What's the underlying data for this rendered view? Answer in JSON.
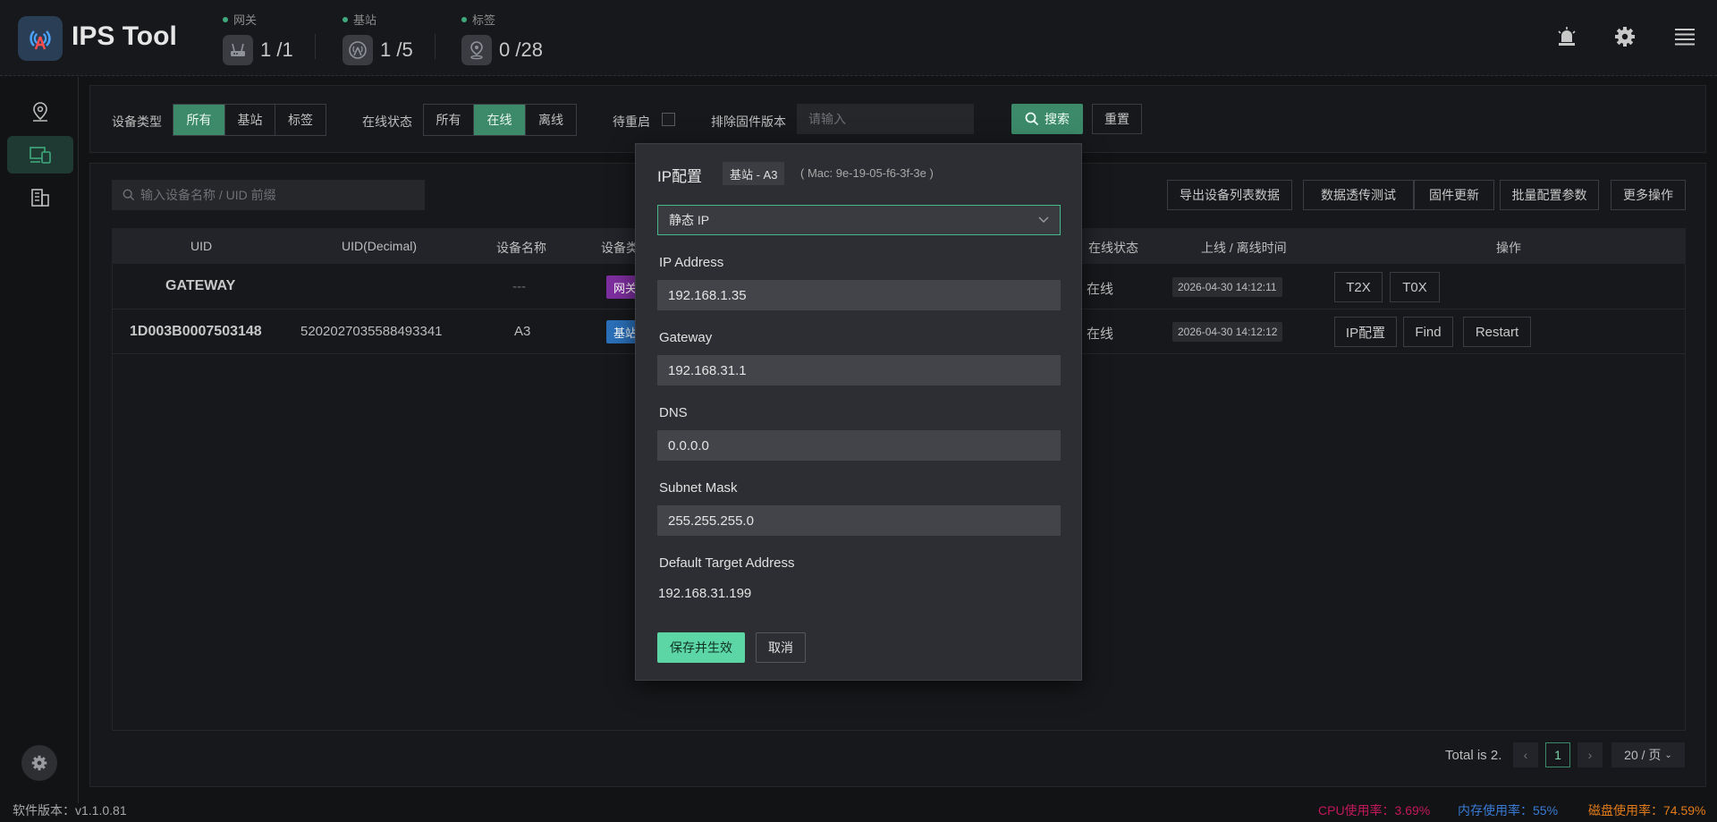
{
  "app": {
    "title": "IPS Tool",
    "version": "软件版本：v1.1.0.81"
  },
  "header": {
    "stats": [
      {
        "label": "网关",
        "value": "1 /1",
        "icon": "router-icon"
      },
      {
        "label": "基站",
        "value": "1 /5",
        "icon": "base-station-icon"
      },
      {
        "label": "标签",
        "value": "0 /28",
        "icon": "tag-location-icon"
      }
    ],
    "right_icons": [
      "alarm-icon",
      "gear-icon",
      "menu-icon"
    ]
  },
  "sidebar": {
    "items": [
      "map-pin-icon",
      "devices-icon",
      "building-icon"
    ],
    "bottom": "settings-icon"
  },
  "filters": {
    "device_type_label": "设备类型",
    "device_type_options": [
      "所有",
      "基站",
      "标签"
    ],
    "online_label": "在线状态",
    "online_options": [
      "所有",
      "在线",
      "离线"
    ],
    "pending_restart_label": "待重启",
    "exclude_fw_label": "排除固件版本",
    "exclude_fw_placeholder": "请输入",
    "search_btn": "搜索",
    "reset_btn": "重置"
  },
  "toolbar": {
    "search_placeholder": "输入设备名称 / UID 前缀",
    "buttons": [
      "导出设备列表数据",
      "数据透传测试",
      "固件更新",
      "批量配置参数",
      "更多操作"
    ]
  },
  "table": {
    "headers": [
      "UID",
      "UID(Decimal)",
      "设备名称",
      "设备类",
      "在线状态",
      "上线 / 离线时间",
      "操作"
    ],
    "rows": [
      {
        "uid": "GATEWAY",
        "uid_dec": "",
        "name": "---",
        "type": "网关",
        "type_color": "#7d2e9e",
        "status": "在线",
        "time": "2026-04-30 14:12:11",
        "actions": [
          "T2X",
          "T0X"
        ]
      },
      {
        "uid": "1D003B0007503148",
        "uid_dec": "5202027035588493341",
        "name": "A3",
        "type": "基站",
        "type_color": "#2a6fb8",
        "status": "在线",
        "time": "2026-04-30 14:12:12",
        "actions": [
          "IP配置",
          "Find",
          "Restart"
        ]
      }
    ]
  },
  "pagination": {
    "total": "Total is 2.",
    "page": "1",
    "size": "20 / 页"
  },
  "footer": {
    "cpu": "CPU使用率：3.69%",
    "mem": "内存使用率：55%",
    "disk": "磁盘使用率：74.59%",
    "cpu_color": "#c2185b",
    "mem_color": "#3a7bd5",
    "disk_color": "#e07a1a"
  },
  "modal": {
    "title": "IP配置",
    "chip": "基站 - A3",
    "mac": "( Mac: 9e-19-05-f6-3f-3e )",
    "mode": "静态 IP",
    "ip_label": "IP Address",
    "ip_value": "192.168.1.35",
    "gw_label": "Gateway",
    "gw_value": "192.168.31.1",
    "dns_label": "DNS",
    "dns_value": "0.0.0.0",
    "mask_label": "Subnet Mask",
    "mask_value": "255.255.255.0",
    "target_label": "Default Target Address",
    "target_value": "192.168.31.199",
    "save": "保存并生效",
    "cancel": "取消"
  }
}
